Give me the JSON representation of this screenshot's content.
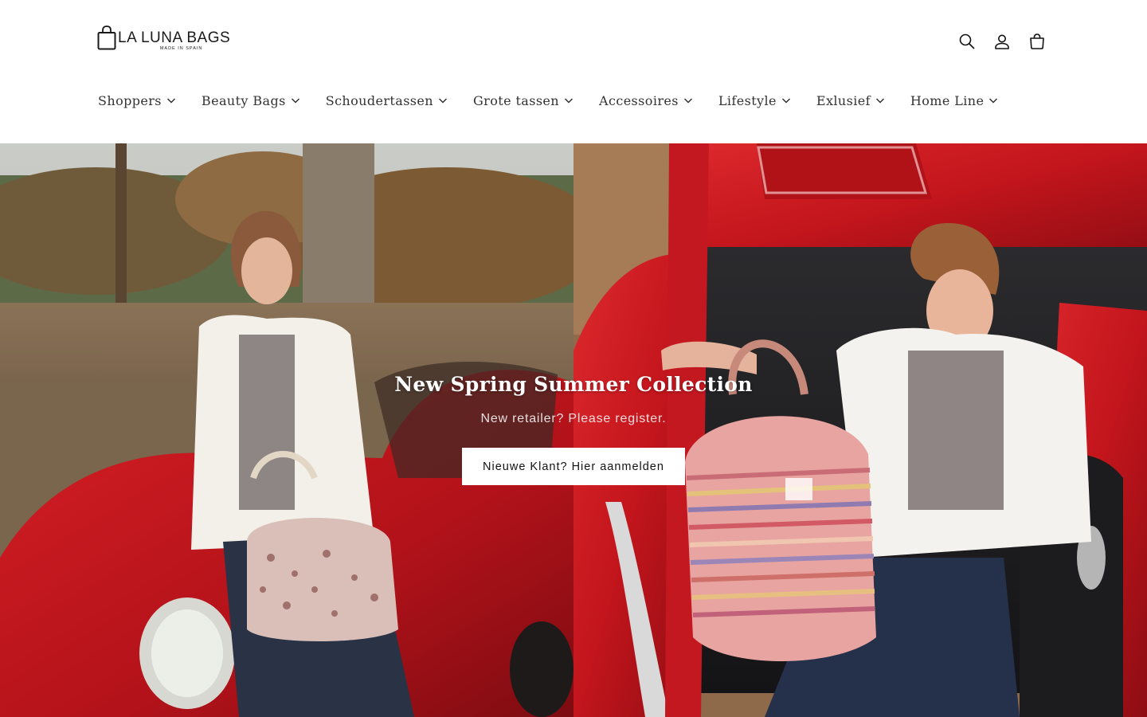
{
  "header": {
    "logo": {
      "name": "LA LUNA BAGS",
      "tagline": "MADE IN SPAIN"
    },
    "icons": [
      {
        "name": "search-icon",
        "label": "Search"
      },
      {
        "name": "account-icon",
        "label": "Log in"
      },
      {
        "name": "cart-icon",
        "label": "Cart"
      }
    ]
  },
  "nav": {
    "items": [
      {
        "label": "Shoppers"
      },
      {
        "label": "Beauty Bags"
      },
      {
        "label": "Schoudertassen"
      },
      {
        "label": "Grote tassen"
      },
      {
        "label": "Accessoires"
      },
      {
        "label": "Lifestyle"
      },
      {
        "label": "Exlusief"
      },
      {
        "label": "Home Line"
      }
    ]
  },
  "hero": {
    "title": "New Spring Summer Collection",
    "subtitle": "New retailer? Please register.",
    "button_label": "Nieuwe Klant? Hier aanmelden"
  },
  "colors": {
    "background": "#ffffff",
    "text": "#121212",
    "nav_text": "#333333",
    "car_red": "#c8161d"
  }
}
